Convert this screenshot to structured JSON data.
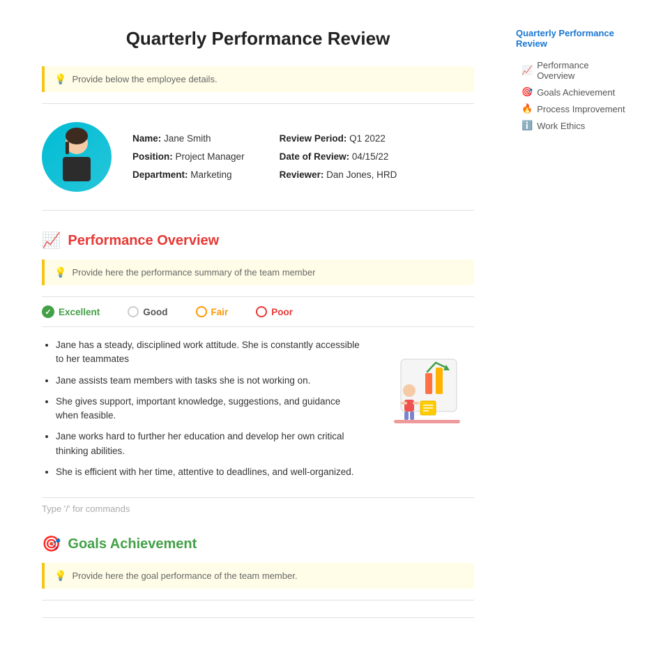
{
  "page": {
    "title": "Quarterly Performance Review"
  },
  "hint_box_1": {
    "icon": "💡",
    "text": "Provide below the employee details."
  },
  "employee": {
    "name_label": "Name:",
    "name_value": "Jane Smith",
    "position_label": "Position:",
    "position_value": "Project Manager",
    "department_label": "Department:",
    "department_value": "Marketing",
    "review_period_label": "Review Period:",
    "review_period_value": "Q1 2022",
    "date_of_review_label": "Date of Review:",
    "date_of_review_value": "04/15/22",
    "reviewer_label": "Reviewer:",
    "reviewer_value": "Dan Jones, HRD"
  },
  "performance_section": {
    "icon": "📈",
    "title": "Performance Overview",
    "hint_icon": "💡",
    "hint_text": "Provide here the performance summary of the team member",
    "ratings": [
      {
        "label": "Excellent",
        "selected": true,
        "color": "excellent"
      },
      {
        "label": "Good",
        "selected": false,
        "color": "good"
      },
      {
        "label": "Fair",
        "selected": false,
        "color": "fair"
      },
      {
        "label": "Poor",
        "selected": false,
        "color": "poor"
      }
    ],
    "bullets": [
      "Jane has a steady, disciplined work attitude. She is constantly accessible to her teammates",
      "Jane assists team members with tasks she is not working on.",
      "She gives support, important knowledge, suggestions, and guidance when feasible.",
      "Jane works hard to further her education and develop her own critical thinking abilities.",
      "She is efficient with her time, attentive to deadlines, and well-organized."
    ],
    "command_hint": "Type '/' for commands"
  },
  "goals_section": {
    "icon": "🎯",
    "title": "Goals Achievement",
    "hint_icon": "💡",
    "hint_text": "Provide here the goal performance of the team member."
  },
  "sidebar": {
    "title": "Quarterly Performance Review",
    "items": [
      {
        "icon": "📈",
        "label": "Performance Overview"
      },
      {
        "icon": "🎯",
        "label": "Goals Achievement"
      },
      {
        "icon": "🔥",
        "label": "Process Improvement"
      },
      {
        "icon": "ℹ️",
        "label": "Work Ethics"
      }
    ]
  }
}
